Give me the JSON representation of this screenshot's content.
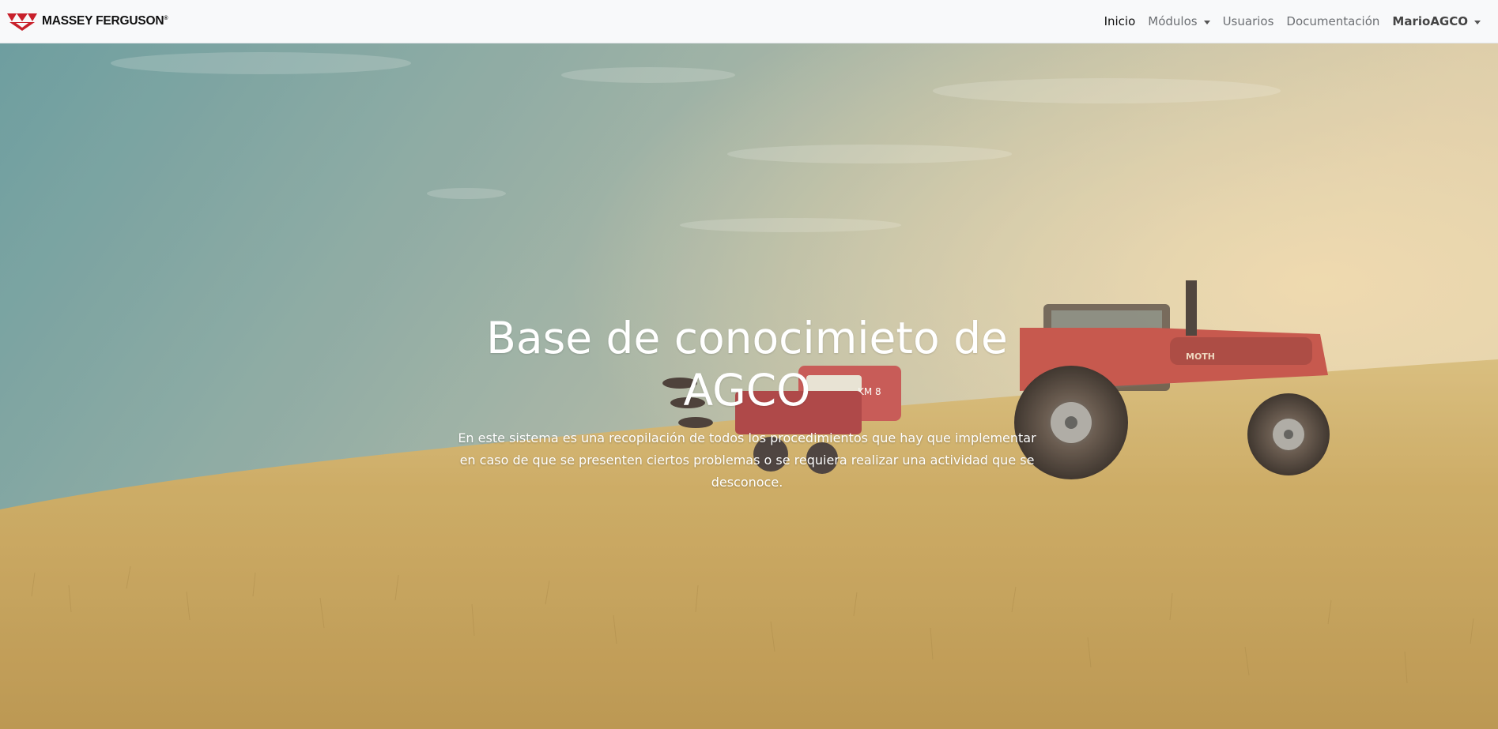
{
  "brand": {
    "name": "MASSEY FERGUSON",
    "registered": "®",
    "logo_icon": "triple-triangle-logo-icon",
    "logo_color": "#c8202b"
  },
  "nav": {
    "inicio": "Inicio",
    "modulos": "Módulos",
    "usuarios": "Usuarios",
    "documentacion": "Documentación",
    "user": "MarioAGCO"
  },
  "hero": {
    "title_line1": "Base de conocimieto de",
    "title_line2": "AGCO",
    "description": "En este sistema es una recopilación de todos los procedimientos que hay que implementar en caso de que se presenten ciertos problemas o se requiera realizar una actividad que se desconoce.",
    "seeder_badge": "KM 8",
    "tractor_badge": "MOTH"
  },
  "colors": {
    "navbar_bg": "#f8f9fa",
    "accent_red": "#c8202b",
    "field_gold": "#c9a55a"
  }
}
